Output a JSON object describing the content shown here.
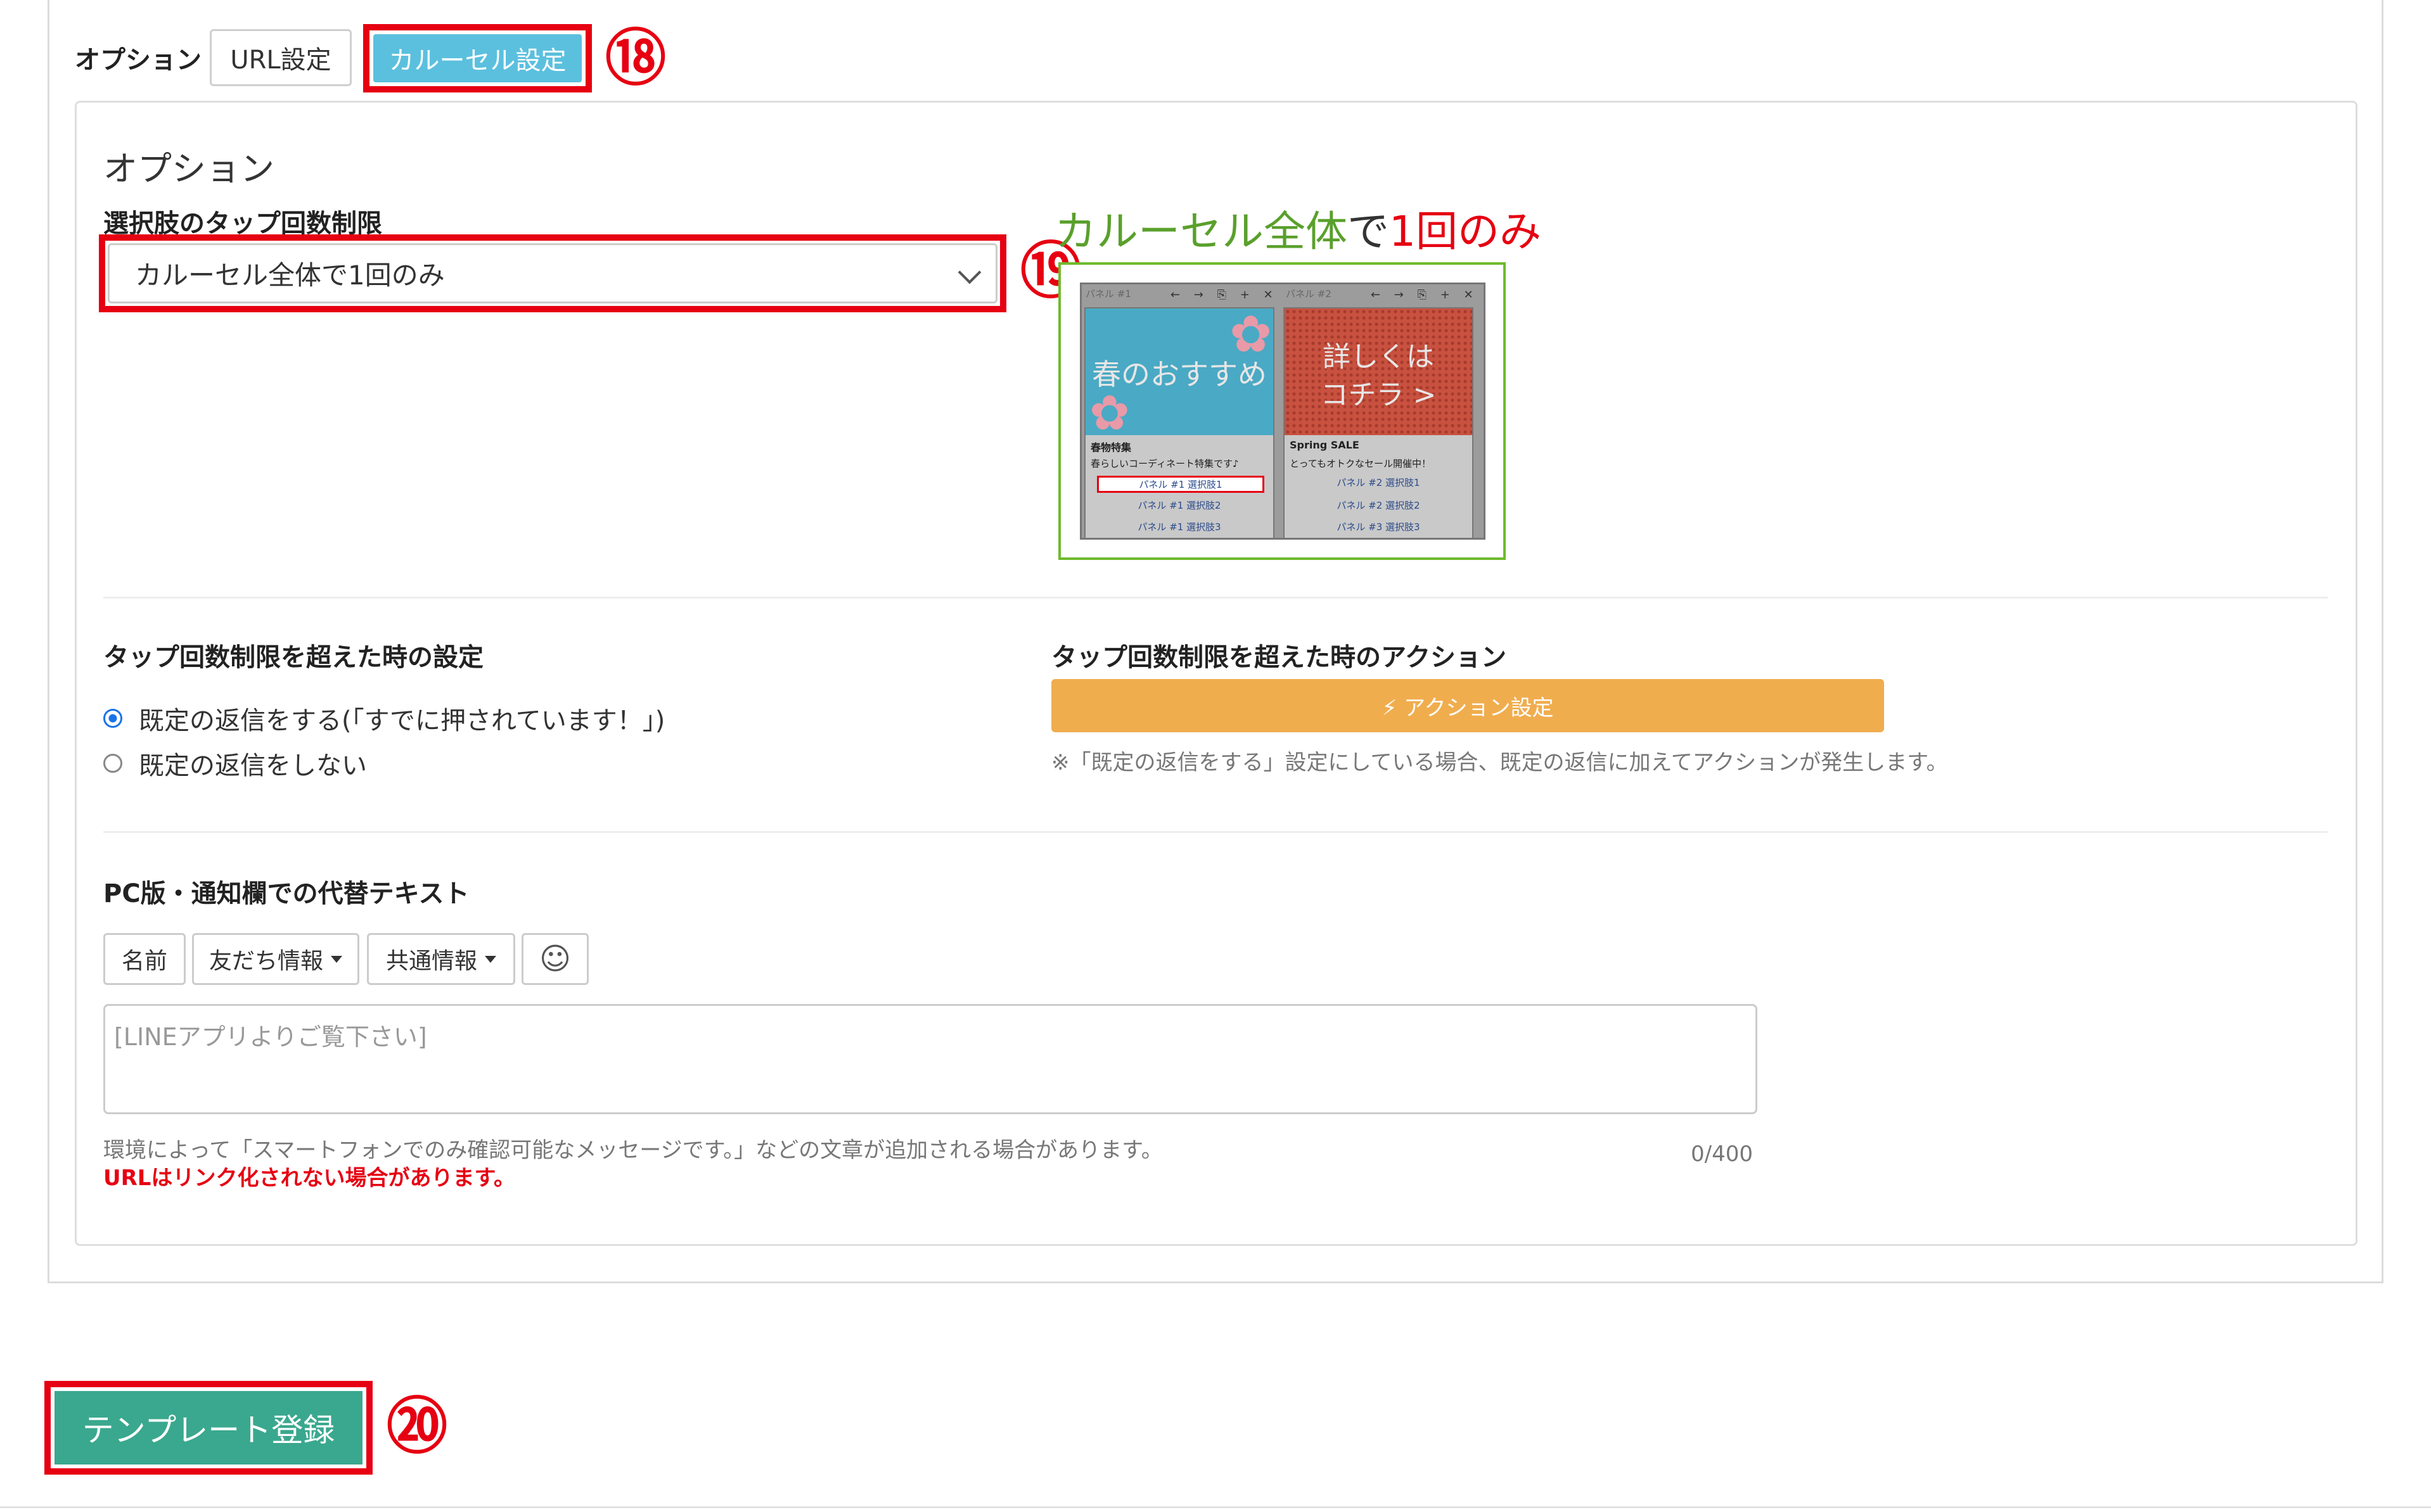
{
  "top": {
    "option_label": "オプション",
    "tab_url": "URL設定",
    "tab_carousel": "カルーセル設定",
    "marker_18": "⑱"
  },
  "options": {
    "section_title": "オプション",
    "tap_limit_label": "選択肢のタップ回数制限",
    "tap_limit_value": "カルーセル全体で1回のみ",
    "marker_19": "⑲",
    "preview_title_a": "カルーセル全体",
    "preview_title_b": "で",
    "preview_title_c": "1回のみ",
    "colors": {
      "accent_red": "#e60012",
      "preview_green": "#5aa02c"
    }
  },
  "preview": {
    "panel1_header": "パネル #1",
    "panel2_header": "パネル #2",
    "panel_icons": "← → ⎘ + ✕",
    "panel1_image_text": "春のおすすめ",
    "panel2_image_text_1": "詳しくは",
    "panel2_image_text_2": "コチラ >",
    "panel1_title": "春物特集",
    "panel1_desc": "春らしいコーディネート特集です♪",
    "panel1_choice1": "パネル #1 選択肢1",
    "panel1_choice2": "パネル #1 選択肢2",
    "panel1_choice3": "パネル #1 選択肢3",
    "panel2_title": "Spring SALE",
    "panel2_desc": "とってもオトクなセール開催中！",
    "panel2_choice1": "パネル #2 選択肢1",
    "panel2_choice2": "パネル #2 選択肢2",
    "panel2_choice3": "パネル #3 選択肢3"
  },
  "over_limit": {
    "setting_label": "タップ回数制限を超えた時の設定",
    "radio_default_reply": "既定の返信をする(「すでに押されています！」)",
    "radio_no_reply": "既定の返信をしない",
    "action_label": "タップ回数制限を超えた時のアクション",
    "action_button": "⚡ アクション設定",
    "action_note": "※「既定の返信をする」設定にしている場合、既定の返信に加えてアクションが発生します。"
  },
  "alt_text": {
    "label": "PC版・通知欄での代替テキスト",
    "btn_name": "名前",
    "btn_friend": "友だち情報",
    "btn_common": "共通情報",
    "emoji_icon": "☺",
    "placeholder": "[LINEアプリよりご覧下さい]",
    "note": "環境によって「スマートフォンでのみ確認可能なメッセージです。」などの文章が追加される場合があります。",
    "warning": "URLはリンク化されない場合があります。",
    "counter": "0/400"
  },
  "footer": {
    "submit": "テンプレート登録",
    "marker_20": "⑳"
  }
}
